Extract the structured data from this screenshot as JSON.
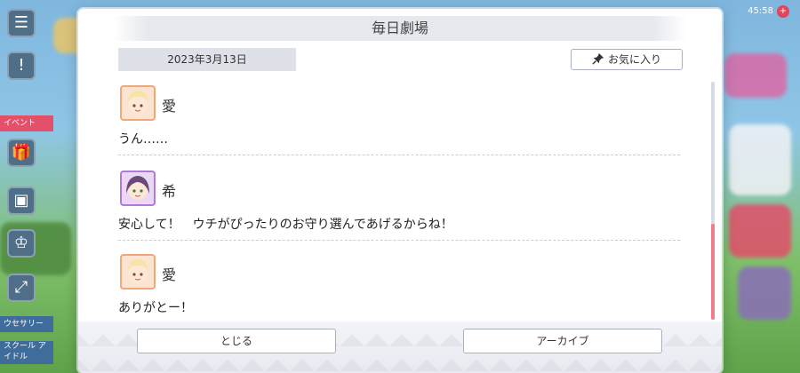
{
  "background": {
    "sidebar_labels": [
      "イベント",
      "ウセサリー",
      "スクール\nアイドル"
    ],
    "top_right_text": "45:58"
  },
  "dialog": {
    "title": "毎日劇場",
    "date": "2023年3月13日",
    "favorite_label": "お気に入り",
    "entries": [
      {
        "speaker": "愛",
        "text": "うん……",
        "avatar": "ai-avatar",
        "frame_color": "#f0a878"
      },
      {
        "speaker": "希",
        "text": "安心して！　ウチがぴったりのお守り選んであげるからね！",
        "avatar": "nozomi-avatar",
        "frame_color": "#b07ad8"
      },
      {
        "speaker": "愛",
        "text": "ありがとー！",
        "avatar": "ai-avatar",
        "frame_color": "#f0a878"
      }
    ],
    "close_label": "とじる",
    "archive_label": "アーカイブ"
  },
  "colors": {
    "scroll_thumb": "#f07c8c",
    "title_bar": "#e6e8ee"
  }
}
